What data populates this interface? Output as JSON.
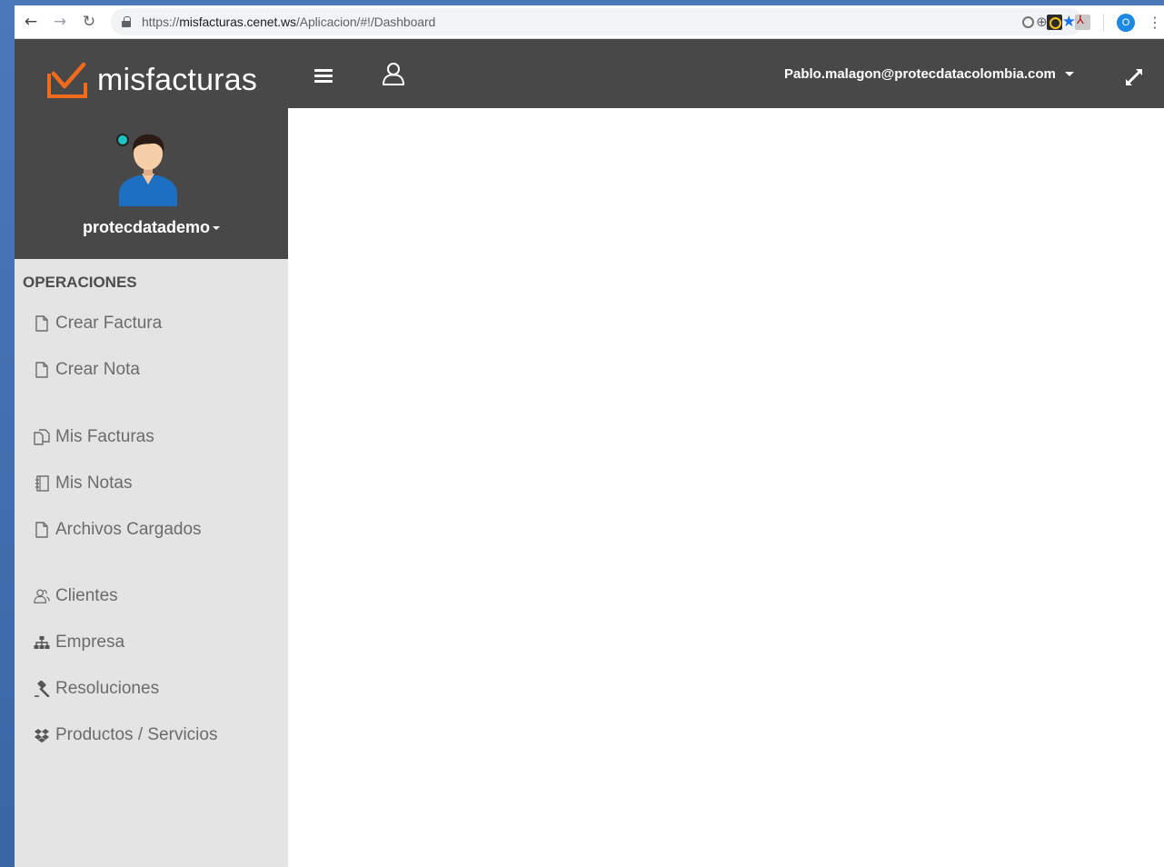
{
  "browser": {
    "url_scheme": "https://",
    "url_host": "misfacturas.cenet.ws",
    "url_path": "/Aplicacion/#!/Dashboard",
    "profile_initial": "O"
  },
  "header": {
    "logo_text": "misfacturas",
    "user_email": "Pablo.malagon@protecdatacolombia.com"
  },
  "profile": {
    "username": "protecdatademo"
  },
  "sidebar": {
    "section_title": "OPERACIONES",
    "items": [
      {
        "label": "Crear Factura",
        "icon": "file-icon"
      },
      {
        "label": "Crear Nota",
        "icon": "file-icon"
      },
      {
        "label": "Mis Facturas",
        "icon": "files-icon"
      },
      {
        "label": "Mis Notas",
        "icon": "notebook-icon"
      },
      {
        "label": "Archivos Cargados",
        "icon": "file-icon"
      },
      {
        "label": "Clientes",
        "icon": "users-icon"
      },
      {
        "label": "Empresa",
        "icon": "sitemap-icon"
      },
      {
        "label": "Resoluciones",
        "icon": "gavel-icon"
      },
      {
        "label": "Productos / Servicios",
        "icon": "dropbox-icon"
      }
    ]
  },
  "colors": {
    "header_bg": "#484848",
    "sidebar_bg": "#e4e4e4",
    "logo_accent": "#f26b1d",
    "status_dot": "#1fc3c3"
  }
}
